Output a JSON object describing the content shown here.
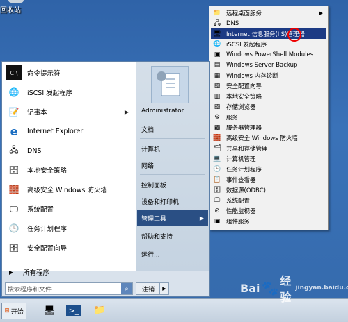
{
  "desktop": {
    "recycle_bin_label": "回收站"
  },
  "start_menu": {
    "pinned_items": [
      {
        "label": "命令提示符",
        "icon": "cmd-icon"
      },
      {
        "label": "iSCSI 发起程序",
        "icon": "iscsi-icon"
      },
      {
        "label": "记事本",
        "icon": "notepad-icon",
        "has_submenu": true
      },
      {
        "label": "Internet Explorer",
        "icon": "ie-icon"
      },
      {
        "label": "DNS",
        "icon": "dns-icon"
      },
      {
        "label": "本地安全策略",
        "icon": "policy-icon"
      },
      {
        "label": "高级安全 Windows 防火墙",
        "icon": "firewall-icon"
      },
      {
        "label": "系统配置",
        "icon": "msconfig-icon"
      },
      {
        "label": "任务计划程序",
        "icon": "scheduler-icon"
      },
      {
        "label": "安全配置向导",
        "icon": "security-wizard-icon"
      }
    ],
    "all_programs_label": "所有程序",
    "search_placeholder": "搜索程序和文件",
    "right_items": [
      {
        "label": "Administrator"
      },
      {
        "label": "文档"
      },
      {
        "label": "计算机"
      },
      {
        "label": "网络"
      },
      {
        "label": "控制面板"
      },
      {
        "label": "设备和打印机"
      },
      {
        "label": "管理工具",
        "has_submenu": true,
        "active": true
      },
      {
        "label": "帮助和支持"
      },
      {
        "label": "运行..."
      }
    ],
    "shutdown_label": "注销"
  },
  "admin_tools_submenu": [
    {
      "label": "远程桌面服务",
      "icon": "folder-icon",
      "has_submenu": true
    },
    {
      "label": "DNS",
      "icon": "dns-icon"
    },
    {
      "label": "Internet 信息服务(IIS)管理器",
      "icon": "iis-icon",
      "highlighted": true
    },
    {
      "label": "iSCSI 发起程序",
      "icon": "iscsi-icon"
    },
    {
      "label": "Windows PowerShell Modules",
      "icon": "powershell-icon"
    },
    {
      "label": "Windows Server Backup",
      "icon": "backup-icon"
    },
    {
      "label": "Windows 内存诊断",
      "icon": "memory-icon"
    },
    {
      "label": "安全配置向导",
      "icon": "security-wizard-icon"
    },
    {
      "label": "本地安全策略",
      "icon": "policy-icon"
    },
    {
      "label": "存储浏览器",
      "icon": "storage-icon"
    },
    {
      "label": "服务",
      "icon": "services-icon"
    },
    {
      "label": "服务器管理器",
      "icon": "server-manager-icon"
    },
    {
      "label": "高级安全 Windows 防火墙",
      "icon": "firewall-icon"
    },
    {
      "label": "共享和存储管理",
      "icon": "share-icon"
    },
    {
      "label": "计算机管理",
      "icon": "computer-management-icon"
    },
    {
      "label": "任务计划程序",
      "icon": "scheduler-icon"
    },
    {
      "label": "事件查看器",
      "icon": "event-viewer-icon"
    },
    {
      "label": "数据源(ODBC)",
      "icon": "odbc-icon"
    },
    {
      "label": "系统配置",
      "icon": "msconfig-icon"
    },
    {
      "label": "性能监视器",
      "icon": "perfmon-icon"
    },
    {
      "label": "组件服务",
      "icon": "component-services-icon"
    }
  ],
  "taskbar": {
    "start_label": "开始"
  },
  "watermark": {
    "text": "Bai",
    "text2": "经验",
    "sub": "jingyan.baidu.com"
  }
}
